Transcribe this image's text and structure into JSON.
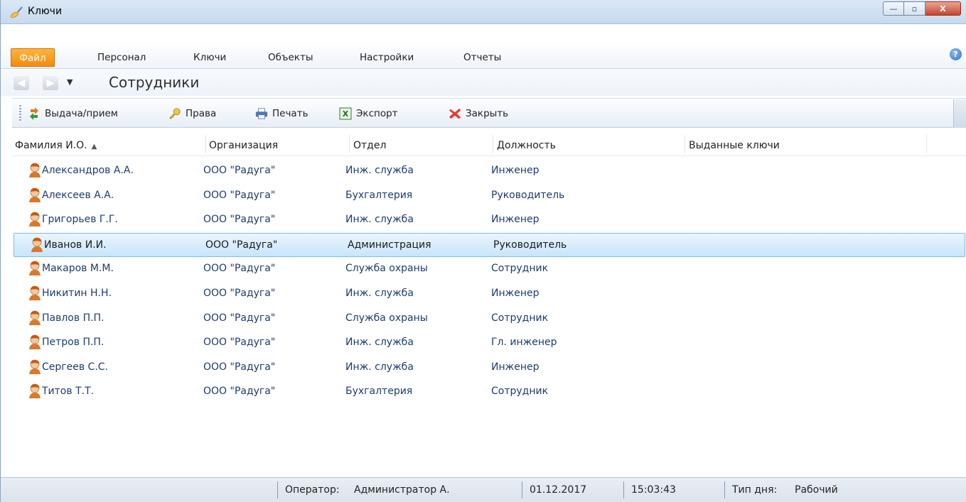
{
  "window": {
    "title": "Ключи",
    "controls": {
      "minimize": "—",
      "maximize": "▫",
      "close": "X"
    }
  },
  "menu": {
    "tabs": [
      {
        "label": "Файл"
      },
      {
        "label": "Персонал"
      },
      {
        "label": "Ключи"
      },
      {
        "label": "Объекты"
      },
      {
        "label": "Настройки"
      },
      {
        "label": "Отчеты"
      }
    ],
    "help_icon": "question-icon",
    "help_glyph": "?"
  },
  "nav": {
    "back_glyph": "◀",
    "forward_glyph": "▶",
    "dropdown_glyph": "▼",
    "section_title": "Сотрудники"
  },
  "toolbar": {
    "items": [
      {
        "label": "Выдача/прием",
        "icon": "issue-return-icon"
      },
      {
        "label": "Права",
        "icon": "keys-rights-icon"
      },
      {
        "label": "Печать",
        "icon": "printer-icon"
      },
      {
        "label": "Экспорт",
        "icon": "excel-export-icon"
      },
      {
        "label": "Закрыть",
        "icon": "close-x-icon"
      }
    ]
  },
  "grid": {
    "columns": [
      "Фамилия И.О.",
      "Организация",
      "Отдел",
      "Должность",
      "Выданные ключи"
    ],
    "sort_indicator": "▲",
    "rows": [
      {
        "name": "Александров А.А.",
        "org": "ООО \"Радуга\"",
        "dept": "Инж. служба",
        "position": "Инженер",
        "keys": "",
        "selected": false
      },
      {
        "name": "Алексеев А.А.",
        "org": "ООО \"Радуга\"",
        "dept": "Бухгалтерия",
        "position": "Руководитель",
        "keys": "",
        "selected": false
      },
      {
        "name": "Григорьев Г.Г.",
        "org": "ООО \"Радуга\"",
        "dept": "Инж. служба",
        "position": "Инженер",
        "keys": "",
        "selected": false
      },
      {
        "name": "Иванов И.И.",
        "org": "ООО \"Радуга\"",
        "dept": "Администрация",
        "position": "Руководитель",
        "keys": "",
        "selected": true
      },
      {
        "name": "Макаров М.М.",
        "org": "ООО \"Радуга\"",
        "dept": "Служба охраны",
        "position": "Сотрудник",
        "keys": "",
        "selected": false
      },
      {
        "name": "Никитин Н.Н.",
        "org": "ООО \"Радуга\"",
        "dept": "Инж. служба",
        "position": "Инженер",
        "keys": "",
        "selected": false
      },
      {
        "name": "Павлов П.П.",
        "org": "ООО \"Радуга\"",
        "dept": "Служба охраны",
        "position": "Сотрудник",
        "keys": "",
        "selected": false
      },
      {
        "name": "Петров П.П.",
        "org": "ООО \"Радуга\"",
        "dept": "Инж. служба",
        "position": "Гл. инженер",
        "keys": "",
        "selected": false
      },
      {
        "name": "Сергеев С.С.",
        "org": "ООО \"Радуга\"",
        "dept": "Инж. служба",
        "position": "Инженер",
        "keys": "",
        "selected": false
      },
      {
        "name": "Титов Т.Т.",
        "org": "ООО \"Радуга\"",
        "dept": "Бухгалтерия",
        "position": "Сотрудник",
        "keys": "",
        "selected": false
      }
    ]
  },
  "status": {
    "operator_label": "Оператор:",
    "operator_value": "Администратор А.",
    "date": "01.12.2017",
    "time": "15:03:43",
    "daytype_label": "Тип дня:",
    "daytype_value": "Рабочий"
  },
  "colors": {
    "file_tab": "#f38a0c",
    "selection": "#c8e5fb",
    "link_text": "#1d3c6e"
  }
}
